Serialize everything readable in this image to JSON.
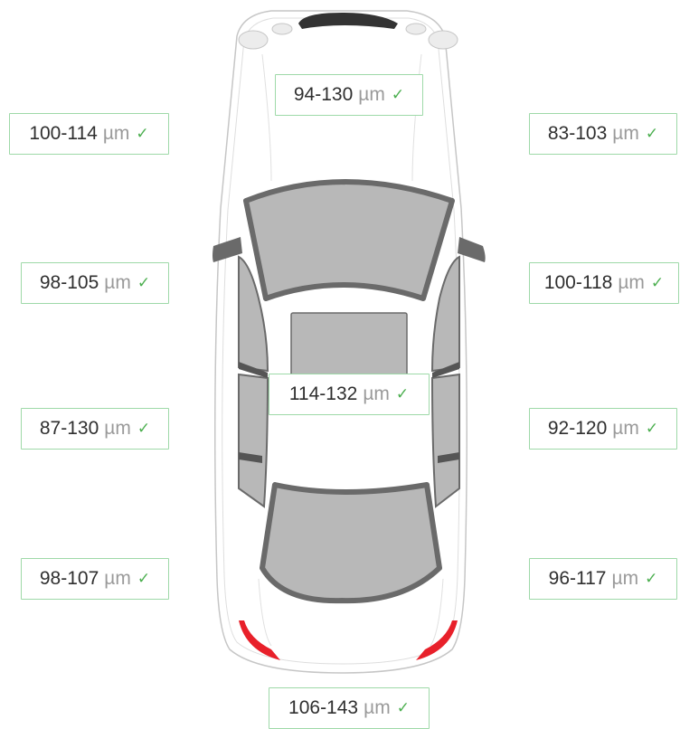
{
  "unit": "µm",
  "check_icon": "check-icon",
  "colors": {
    "label_border": "#9ed9a8",
    "check": "#4caf50",
    "tail_lights": "#e8202a",
    "glass": "#b8b8b8",
    "glass_frame": "#6a6a6a"
  },
  "measurements": {
    "hood": "94-130",
    "front_left_fender": "100-114",
    "front_right_fender": "83-103",
    "front_left_door": "98-105",
    "front_right_door": "100-118",
    "roof": "114-132",
    "rear_left_door": "87-130",
    "rear_right_door": "92-120",
    "rear_left_fender": "98-107",
    "rear_right_fender": "96-117",
    "trunk": "106-143"
  }
}
